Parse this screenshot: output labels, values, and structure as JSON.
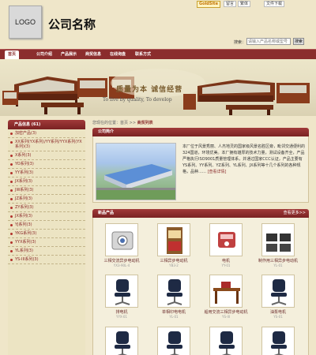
{
  "header": {
    "logo": "LOGO",
    "company_name": "公司名称",
    "goldsite": "GoldSite",
    "top_links": [
      "留言",
      "繁体",
      "文件下载"
    ],
    "search_label": "搜索：",
    "search_placeholder": "请输入产品名称或型号",
    "search_button": "搜索"
  },
  "nav": {
    "items": [
      "首页",
      "公司介绍",
      "产品展示",
      "商贸信息",
      "在线询盘",
      "联系方式"
    ]
  },
  "banner": {
    "slogan": "质量为本  诚信经营",
    "slogan_en": "To live by quality, To develop"
  },
  "sidebar": {
    "title": "产品信息 (61)",
    "items": [
      "加密产品(3)",
      "XX系列(YX系列)/YY系列/YYX系列(YX系列)(3)",
      "X系列(3)",
      "YO系列(3)",
      "YY系列(3)",
      "JX系列(3)",
      "JW系列(3)",
      "JZ系列(3)",
      "ZY系列(3)",
      "JX系列(3)",
      "YJ系列(3)",
      "YKG系列(3)",
      "YYX系列(3)",
      "YL系列(3)",
      "YS-III系列(3)"
    ]
  },
  "main": {
    "breadcrumb": {
      "prefix": "您现在的位置：",
      "home": "首页",
      "sep": ">>",
      "current": "商贸列表"
    },
    "intro": {
      "title": "公司简介",
      "text": "本厂位于风景秀丽、人杰地灵的国家级风景名胜区旁，毗邻交通便利的324国道，环境优美。本厂拥有雄厚的技术力量，测试设备齐全，产品严格执行ISO9001质量管理体系，并通过国家CCC认证，产品主要有YS系列、YY系列、YZ系列、YL系列、JX系列等十几个系列的各种规格，品种……",
      "more": "[查看详情]"
    },
    "products": {
      "title": "新品产品",
      "more": "查看更多>>",
      "items": [
        {
          "name": "三相交流异步电动机",
          "model": "YX3-90L-4",
          "icon": "camera-icon"
        },
        {
          "name": "三相异步电动机",
          "model": "YB3-2",
          "icon": "book-icon"
        },
        {
          "name": "电机",
          "model": "YY-01",
          "icon": "phone-icon"
        },
        {
          "name": "制作用三相异步电动机",
          "model": "YL-01",
          "icon": "tools-icon"
        },
        {
          "name": "排电机",
          "model": "YYX-01",
          "icon": "chair-icon"
        },
        {
          "name": "单相印电电机",
          "model": "YL-01",
          "icon": "chair-icon"
        },
        {
          "name": "船用交流三相异步电动机",
          "model": "YS-III",
          "icon": "desk-icon"
        },
        {
          "name": "油泵电机",
          "model": "YS-01",
          "icon": "chair-icon"
        },
        {
          "name": "",
          "model": "",
          "icon": "chair-icon"
        },
        {
          "name": "",
          "model": "",
          "icon": "chair-icon"
        },
        {
          "name": "",
          "model": "",
          "icon": "chair-icon"
        },
        {
          "name": "",
          "model": "",
          "icon": "chair-icon"
        }
      ]
    }
  },
  "colors": {
    "accent": "#8b2d2d",
    "background": "#efe6c9"
  }
}
